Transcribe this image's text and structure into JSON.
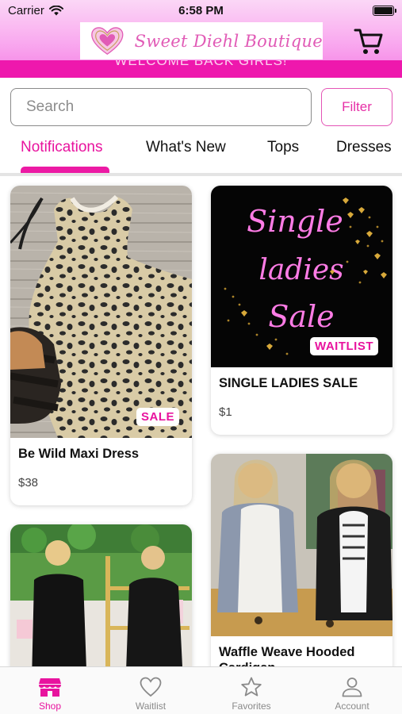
{
  "status_bar": {
    "carrier": "Carrier",
    "time": "6:58 PM"
  },
  "header": {
    "logo_text": "Sweet Diehl Boutique",
    "welcome": "WELCOME BACK GIRLS!"
  },
  "search": {
    "placeholder": "Search",
    "value": "",
    "filter_label": "Filter"
  },
  "tabs": [
    {
      "label": "Notifications",
      "active": true
    },
    {
      "label": "What's New",
      "active": false
    },
    {
      "label": "Tops",
      "active": false
    },
    {
      "label": "Dresses",
      "active": false
    }
  ],
  "products": [
    {
      "title": "Be Wild Maxi Dress",
      "price": "$38",
      "badge": "SALE"
    },
    {
      "title": "SINGLE LADIES SALE",
      "price": "$1",
      "badge": "WAITLIST",
      "image_text": [
        "Single",
        "ladies",
        "Sale"
      ]
    },
    {
      "title": "",
      "price": "",
      "badge": ""
    },
    {
      "title": "Waffle Weave Hooded Cardigan",
      "price": "",
      "badge": ""
    }
  ],
  "bottom_nav": [
    {
      "label": "Shop",
      "icon": "shop-icon",
      "active": true
    },
    {
      "label": "Waitlist",
      "icon": "heart-icon",
      "active": false
    },
    {
      "label": "Favorites",
      "icon": "star-icon",
      "active": false
    },
    {
      "label": "Account",
      "icon": "person-icon",
      "active": false
    }
  ],
  "colors": {
    "accent": "#e8139e",
    "welcome_band": "#ee18ad",
    "header_gradient_top": "#fbd7f6",
    "header_gradient_bottom": "#f57fe3"
  }
}
